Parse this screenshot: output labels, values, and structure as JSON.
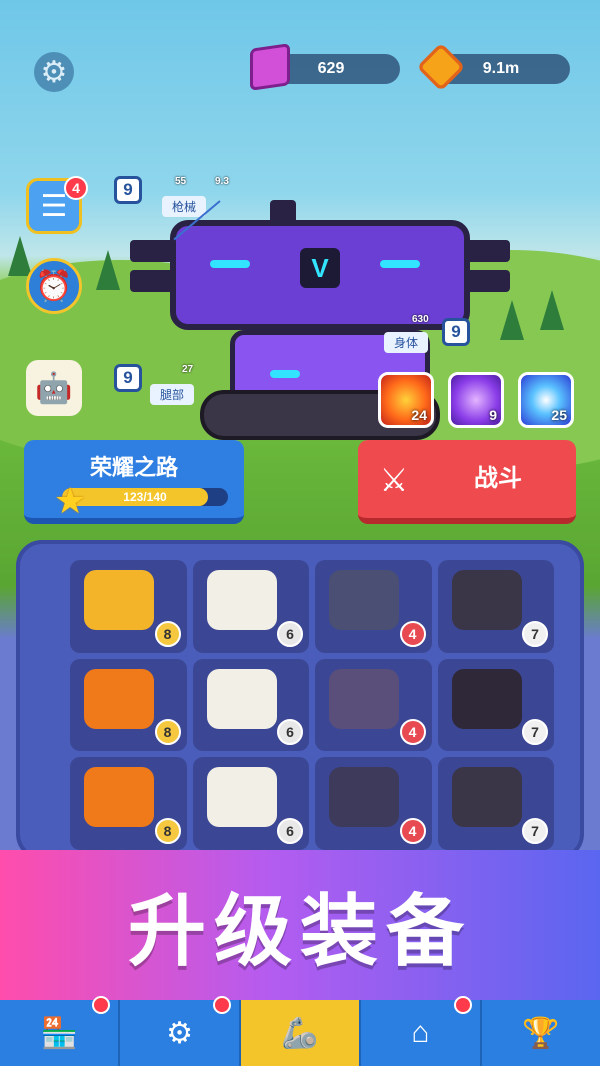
{
  "resources": {
    "gems": "629",
    "coins": "9.1m"
  },
  "notifications": {
    "missions_badge": "4"
  },
  "robot_parts": {
    "weapon": {
      "level": "9",
      "label": "枪械",
      "stat_a": "55",
      "stat_b": "9.3"
    },
    "body": {
      "level": "9",
      "label": "身体",
      "stat_a": "630"
    },
    "legs": {
      "level": "9",
      "label": "腿部",
      "stat_a": "27"
    }
  },
  "skills": [
    {
      "name": "fire",
      "count": "24"
    },
    {
      "name": "drone",
      "count": "9"
    },
    {
      "name": "energy",
      "count": "25"
    }
  ],
  "glory_road": {
    "title": "荣耀之路",
    "progress_text": "123/140",
    "progress": 0.878
  },
  "fight": {
    "label": "战斗"
  },
  "inventory": [
    {
      "name": "cannon-part",
      "level": "8",
      "color": "#f4b42a"
    },
    {
      "name": "armor-part",
      "level": "6",
      "color": "#f2efe6"
    },
    {
      "name": "blaster-part",
      "level": "4",
      "color": "#4a4f73"
    },
    {
      "name": "claw-part",
      "level": "7",
      "color": "#3a3547"
    },
    {
      "name": "orange-legs-part",
      "level": "8",
      "color": "#f07a1a"
    },
    {
      "name": "white-body-part",
      "level": "6",
      "color": "#f2efe6"
    },
    {
      "name": "purple-body-part",
      "level": "4",
      "color": "#5a4e7a"
    },
    {
      "name": "dark-body-part",
      "level": "7",
      "color": "#2f2838"
    },
    {
      "name": "orange-gun-part",
      "level": "8",
      "color": "#f07a1a"
    },
    {
      "name": "white-legs-part",
      "level": "6",
      "color": "#f2efe6"
    },
    {
      "name": "purple-legs-part",
      "level": "4",
      "color": "#3e3a5c"
    },
    {
      "name": "dark-legs-part",
      "level": "7",
      "color": "#3a3547"
    }
  ],
  "banner": {
    "text": "升级装备"
  },
  "bottom_nav": [
    "shop",
    "parts",
    "assemble",
    "garage",
    "trophy"
  ]
}
